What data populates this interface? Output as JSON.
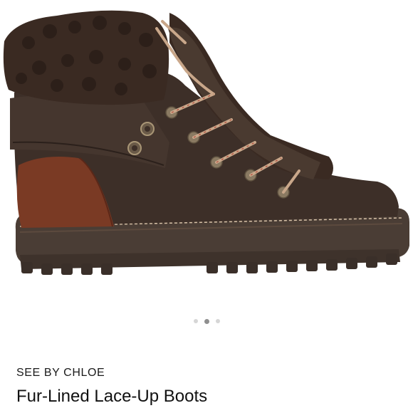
{
  "product": {
    "brand": "SEE BY CHLOE",
    "name": "Fur-Lined Lace-Up Boots",
    "image_icon": "brown-shearling-hiking-boot",
    "colors": {
      "suede": "#3d2f28",
      "shearling": "#3a2a22",
      "leather_heel": "#7a3a24",
      "sole": "#4a3d35",
      "laces": "#c9a78a"
    }
  },
  "carousel": {
    "slide_count": 3,
    "active_index": 1
  }
}
